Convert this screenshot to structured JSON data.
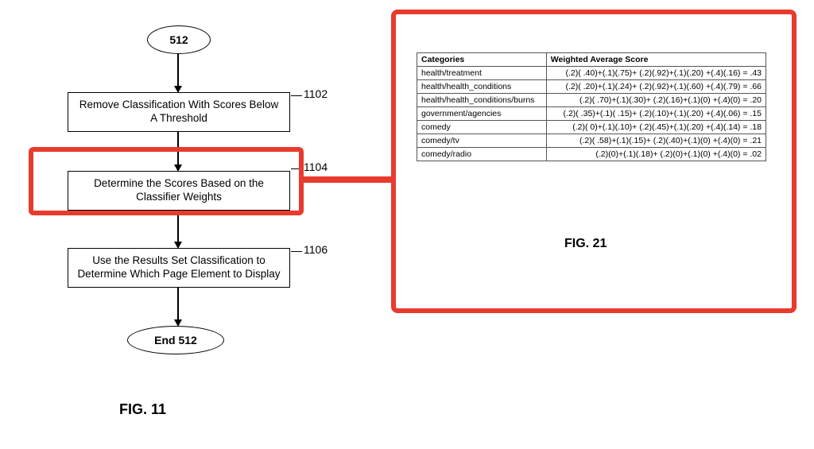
{
  "flowchart": {
    "start": "512",
    "box1": "Remove Classification With Scores Below A Threshold",
    "box2": "Determine the Scores Based on the Classifier Weights",
    "box3": "Use the Results Set Classification to Determine Which Page Element to Display",
    "end": "End 512",
    "ref1": "1102",
    "ref2": "1104",
    "ref3": "1106",
    "fig_label": "FIG. 11"
  },
  "table": {
    "headers": {
      "col1": "Categories",
      "col2": "Weighted Average Score"
    },
    "rows": [
      {
        "category": "health/treatment",
        "score": "(.2)( .40)+(.1)(.75)+ (.2)(.92)+(.1)(.20) +(.4)(.16) = .43"
      },
      {
        "category": "health/health_conditions",
        "score": "(.2)( .20)+(.1)(.24)+ (.2)(.92)+(.1)(.60) +(.4)(.79) = .66"
      },
      {
        "category": "health/health_conditions/burns",
        "score": "(.2)( .70)+(.1)(.30)+ (.2)(.16)+(.1)(0) +(.4)(0) = .20"
      },
      {
        "category": "government/agencies",
        "score": "(.2)( .35)+(.1)( .15)+ (.2)(.10)+(.1)(.20) +(.4)(.06) = .15"
      },
      {
        "category": "comedy",
        "score": "(.2)( 0)+(.1)(.10)+ (.2)(.45)+(.1)(.20) +(.4)(.14) = .18"
      },
      {
        "category": "comedy/tv",
        "score": "(.2)( .58)+(.1)(.15)+ (.2)(.40)+(.1)(0) +(.4)(0) = .21"
      },
      {
        "category": "comedy/radio",
        "score": "(.2)(0)+(.1)(.18)+ (.2)(0)+(.1)(0) +(.4)(0) = .02"
      }
    ],
    "fig_label": "FIG. 21"
  }
}
